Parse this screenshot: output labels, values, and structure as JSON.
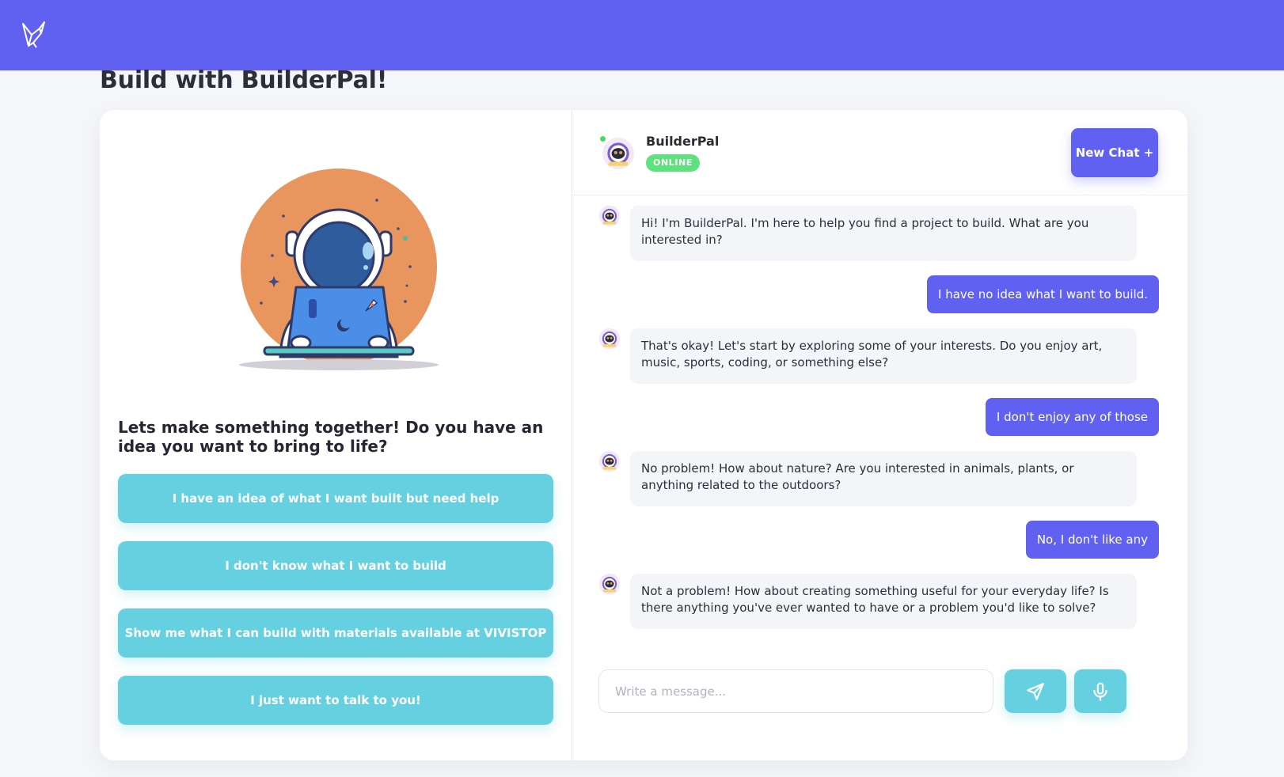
{
  "page": {
    "title": "Build with BuilderPal!"
  },
  "topbar": {
    "logo": "origami-bird-icon",
    "color": "#6161f1"
  },
  "left_panel": {
    "prompt": "Lets make something together! Do you have an idea you want to bring to life?",
    "illustration": "astronaut-with-laptop",
    "choices": [
      {
        "label": "I have an idea of what I want built but need help"
      },
      {
        "label": "I don't know what I want to build"
      },
      {
        "label": "Show me what I can build with materials available at VIVISTOP"
      },
      {
        "label": "I just want to talk to you!"
      }
    ],
    "choice_color": "#64d0e0"
  },
  "chat": {
    "bot_name": "BuilderPal",
    "status": "ONLINE",
    "new_chat_label": "New Chat +",
    "messages": [
      {
        "from": "bot",
        "text": "Hi! I'm BuilderPal. I'm here to help you find a project to build. What are you interested in?"
      },
      {
        "from": "user",
        "text": "I have no idea what I want to build."
      },
      {
        "from": "bot",
        "text": "That's okay! Let's start by exploring some of your interests. Do you enjoy art, music, sports, coding, or something else?"
      },
      {
        "from": "user",
        "text": "I don't enjoy any of those"
      },
      {
        "from": "bot",
        "text": "No problem! How about nature? Are you interested in animals, plants, or anything related to the outdoors?"
      },
      {
        "from": "user",
        "text": "No, I don't like any"
      },
      {
        "from": "bot",
        "text": "Not a problem! How about creating something useful for your everyday life? Is there anything you've ever wanted to have or a problem you'd like to solve?"
      }
    ],
    "input_placeholder": "Write a message...",
    "send_icon": "paper-plane-icon",
    "mic_icon": "microphone-icon",
    "accent": "#6161f1",
    "online_color": "#5ee27d"
  }
}
